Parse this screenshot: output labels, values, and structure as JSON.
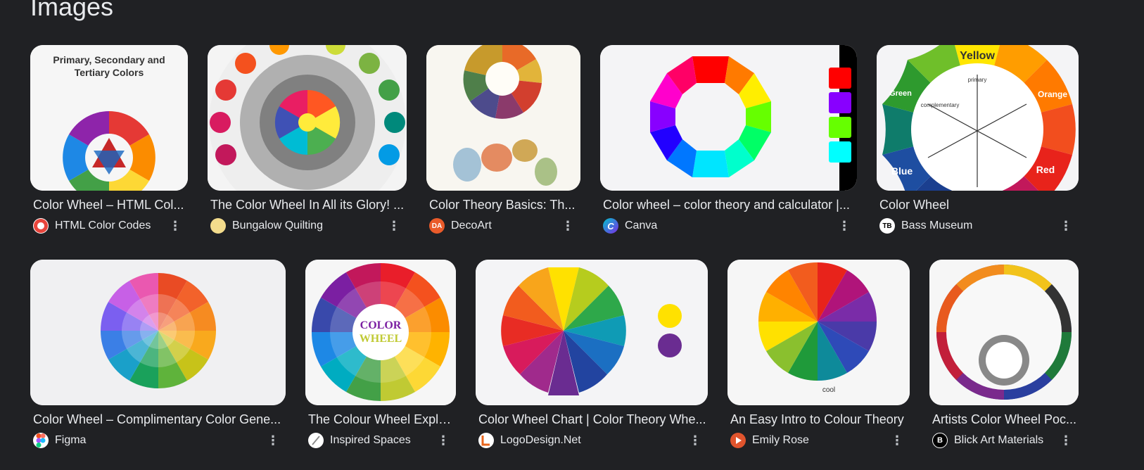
{
  "section": {
    "title": "Images"
  },
  "row1": [
    {
      "caption": "Color Wheel – HTML Col...",
      "source": "HTML Color Codes",
      "thumb_text": [
        "Primary, Secondary and",
        "Tertiary Colors"
      ],
      "favicon_icon": "html-color-codes-logo",
      "favicon_color": "#e8453c"
    },
    {
      "caption": "The Color Wheel In All its Glory! ...",
      "source": "Bungalow Quilting",
      "favicon_icon": "bungalow-quilting-logo",
      "favicon_color": "#f3dc8c"
    },
    {
      "caption": "Color Theory Basics: Th...",
      "source": "DecoArt",
      "favicon_text": "DA",
      "favicon_color": "#ea5b2a"
    },
    {
      "caption": "Color wheel – color theory and calculator |...",
      "source": "Canva",
      "favicon_text": "C",
      "favicon_color": "#7d2ae8"
    },
    {
      "caption": "Color Wheel",
      "source": "Bass Museum",
      "favicon_text": "TB",
      "favicon_color": "#ffffff",
      "thumb_labels": [
        "Yellow",
        "Orange",
        "Red",
        "Blue",
        "Green",
        "primary",
        "complementary"
      ]
    }
  ],
  "row2": [
    {
      "caption": "Color Wheel – Complimentary Color Gene...",
      "source": "Figma",
      "favicon_icon": "figma-logo",
      "favicon_color": "#ffffff"
    },
    {
      "caption": "The Colour Wheel Expla...",
      "source": "Inspired Spaces",
      "favicon_icon": "inspired-spaces-logo",
      "favicon_color": "#ffffff",
      "thumb_text": [
        "COLOR",
        "WHEEL"
      ]
    },
    {
      "caption": "Color Wheel Chart | Color Theory Whe...",
      "source": "LogoDesign.Net",
      "favicon_icon": "logodesign-logo",
      "favicon_color": "#ffffff"
    },
    {
      "caption": "An Easy Intro to Colour Theory",
      "source": "Emily Rose",
      "favicon_icon": "play-icon",
      "favicon_color": "#e0542d",
      "thumb_text": [
        "cool"
      ]
    },
    {
      "caption": "Artists Color Wheel Poc...",
      "source": "Blick Art Materials",
      "favicon_text": "B",
      "favicon_color": "#111111"
    }
  ],
  "more_label": "⋮",
  "colors": {
    "background": "#202124",
    "text": "#e8eaed",
    "thumb_bg": "#f4f4f6"
  }
}
